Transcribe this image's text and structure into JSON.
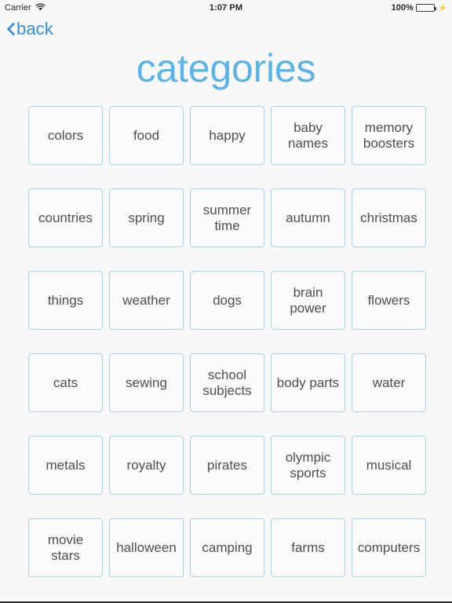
{
  "statusbar": {
    "carrier": "Carrier",
    "wifi_icon": "wifi-icon",
    "time": "1:07 PM",
    "battery_percent": "100%",
    "battery_level": 100,
    "battery_color": "#4cd964",
    "charging_icon": "lightning-bolt-icon"
  },
  "nav": {
    "back_label": "back",
    "back_icon": "chevron-left-icon",
    "accent_color": "#2f8fdd"
  },
  "header": {
    "title": "categories",
    "title_color": "#5bb4e5"
  },
  "grid": {
    "columns": 5,
    "tile_border_color": "#a4d3ef",
    "tile_text_color": "#4f4f4f",
    "tiles": [
      {
        "label": "colors"
      },
      {
        "label": "food"
      },
      {
        "label": "happy"
      },
      {
        "label": "baby\nnames"
      },
      {
        "label": "memory\nboosters"
      },
      {
        "label": "countries"
      },
      {
        "label": "spring"
      },
      {
        "label": "summer\ntime"
      },
      {
        "label": "autumn"
      },
      {
        "label": "christmas"
      },
      {
        "label": "things"
      },
      {
        "label": "weather"
      },
      {
        "label": "dogs"
      },
      {
        "label": "brain\npower"
      },
      {
        "label": "flowers"
      },
      {
        "label": "cats"
      },
      {
        "label": "sewing"
      },
      {
        "label": "school\nsubjects"
      },
      {
        "label": "body parts"
      },
      {
        "label": "water"
      },
      {
        "label": "metals"
      },
      {
        "label": "royalty"
      },
      {
        "label": "pirates"
      },
      {
        "label": "olympic\nsports"
      },
      {
        "label": "musical"
      },
      {
        "label": "movie\nstars"
      },
      {
        "label": "halloween"
      },
      {
        "label": "camping"
      },
      {
        "label": "farms"
      },
      {
        "label": "computers"
      }
    ]
  }
}
